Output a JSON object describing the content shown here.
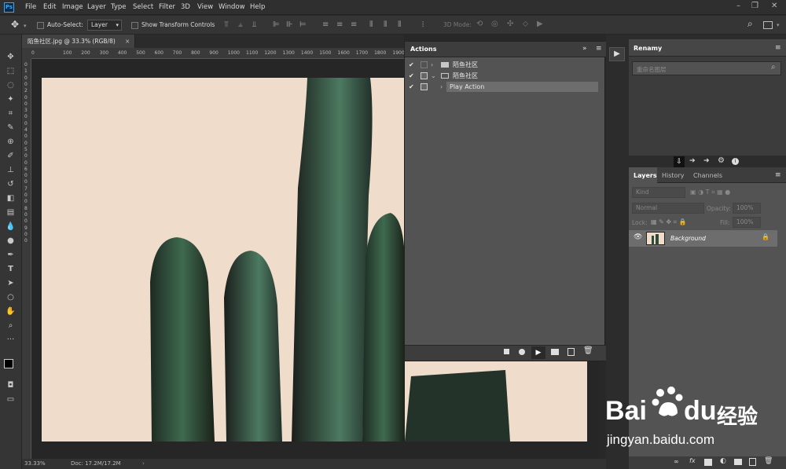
{
  "app": {
    "logo": "Ps",
    "accent": "#31a8ff"
  },
  "menu": [
    "File",
    "Edit",
    "Image",
    "Layer",
    "Type",
    "Select",
    "Filter",
    "3D",
    "View",
    "Window",
    "Help"
  ],
  "window_controls": [
    "–",
    "❐",
    "✕"
  ],
  "options": {
    "auto_select_label": "Auto-Select:",
    "auto_select_value": "Layer",
    "transform_label": "Show Transform Controls",
    "mode_3d": "3D Mode:"
  },
  "document": {
    "tab_title": "陌鱼社区.jpg @ 33.3% (RGB/8)",
    "close": "×",
    "zoom": "33.33%",
    "doc_info": "Doc: 17.2M/17.2M"
  },
  "rulers": {
    "h": [
      "0",
      "100",
      "200",
      "300",
      "400",
      "500",
      "600",
      "700",
      "800",
      "900",
      "1000",
      "1100",
      "1200",
      "1300",
      "1400",
      "1500",
      "1600",
      "1700",
      "1800",
      "1900"
    ],
    "v": [
      "0",
      "1",
      "0",
      "0",
      "2",
      "0",
      "0",
      "3",
      "0",
      "0",
      "4",
      "0",
      "0",
      "5",
      "0",
      "0",
      "6",
      "0",
      "0",
      "7",
      "0",
      "0",
      "8",
      "0",
      "0",
      "9",
      "0",
      "0"
    ]
  },
  "actions_panel": {
    "title": "Actions",
    "rows": [
      {
        "label": "陌鱼社区",
        "icon": "folder-icon"
      },
      {
        "label": "陌鱼社区",
        "icon": "folder-icon"
      },
      {
        "label": "Play Action",
        "icon": ""
      }
    ]
  },
  "renamy": {
    "title": "Renamy",
    "placeholder": "重命名图层"
  },
  "layers": {
    "tabs": [
      "Layers",
      "History",
      "Channels"
    ],
    "kind": "Kind",
    "blend": "Normal",
    "opacity_label": "Opacity:",
    "opacity": "100%",
    "lock_label": "Lock:",
    "fill_label": "Fill:",
    "fill": "100%",
    "layer_name": "Background"
  },
  "watermark": {
    "brand": "Bai",
    "brand2": "du",
    "cn": "经验",
    "url": "jingyan.baidu.com"
  }
}
